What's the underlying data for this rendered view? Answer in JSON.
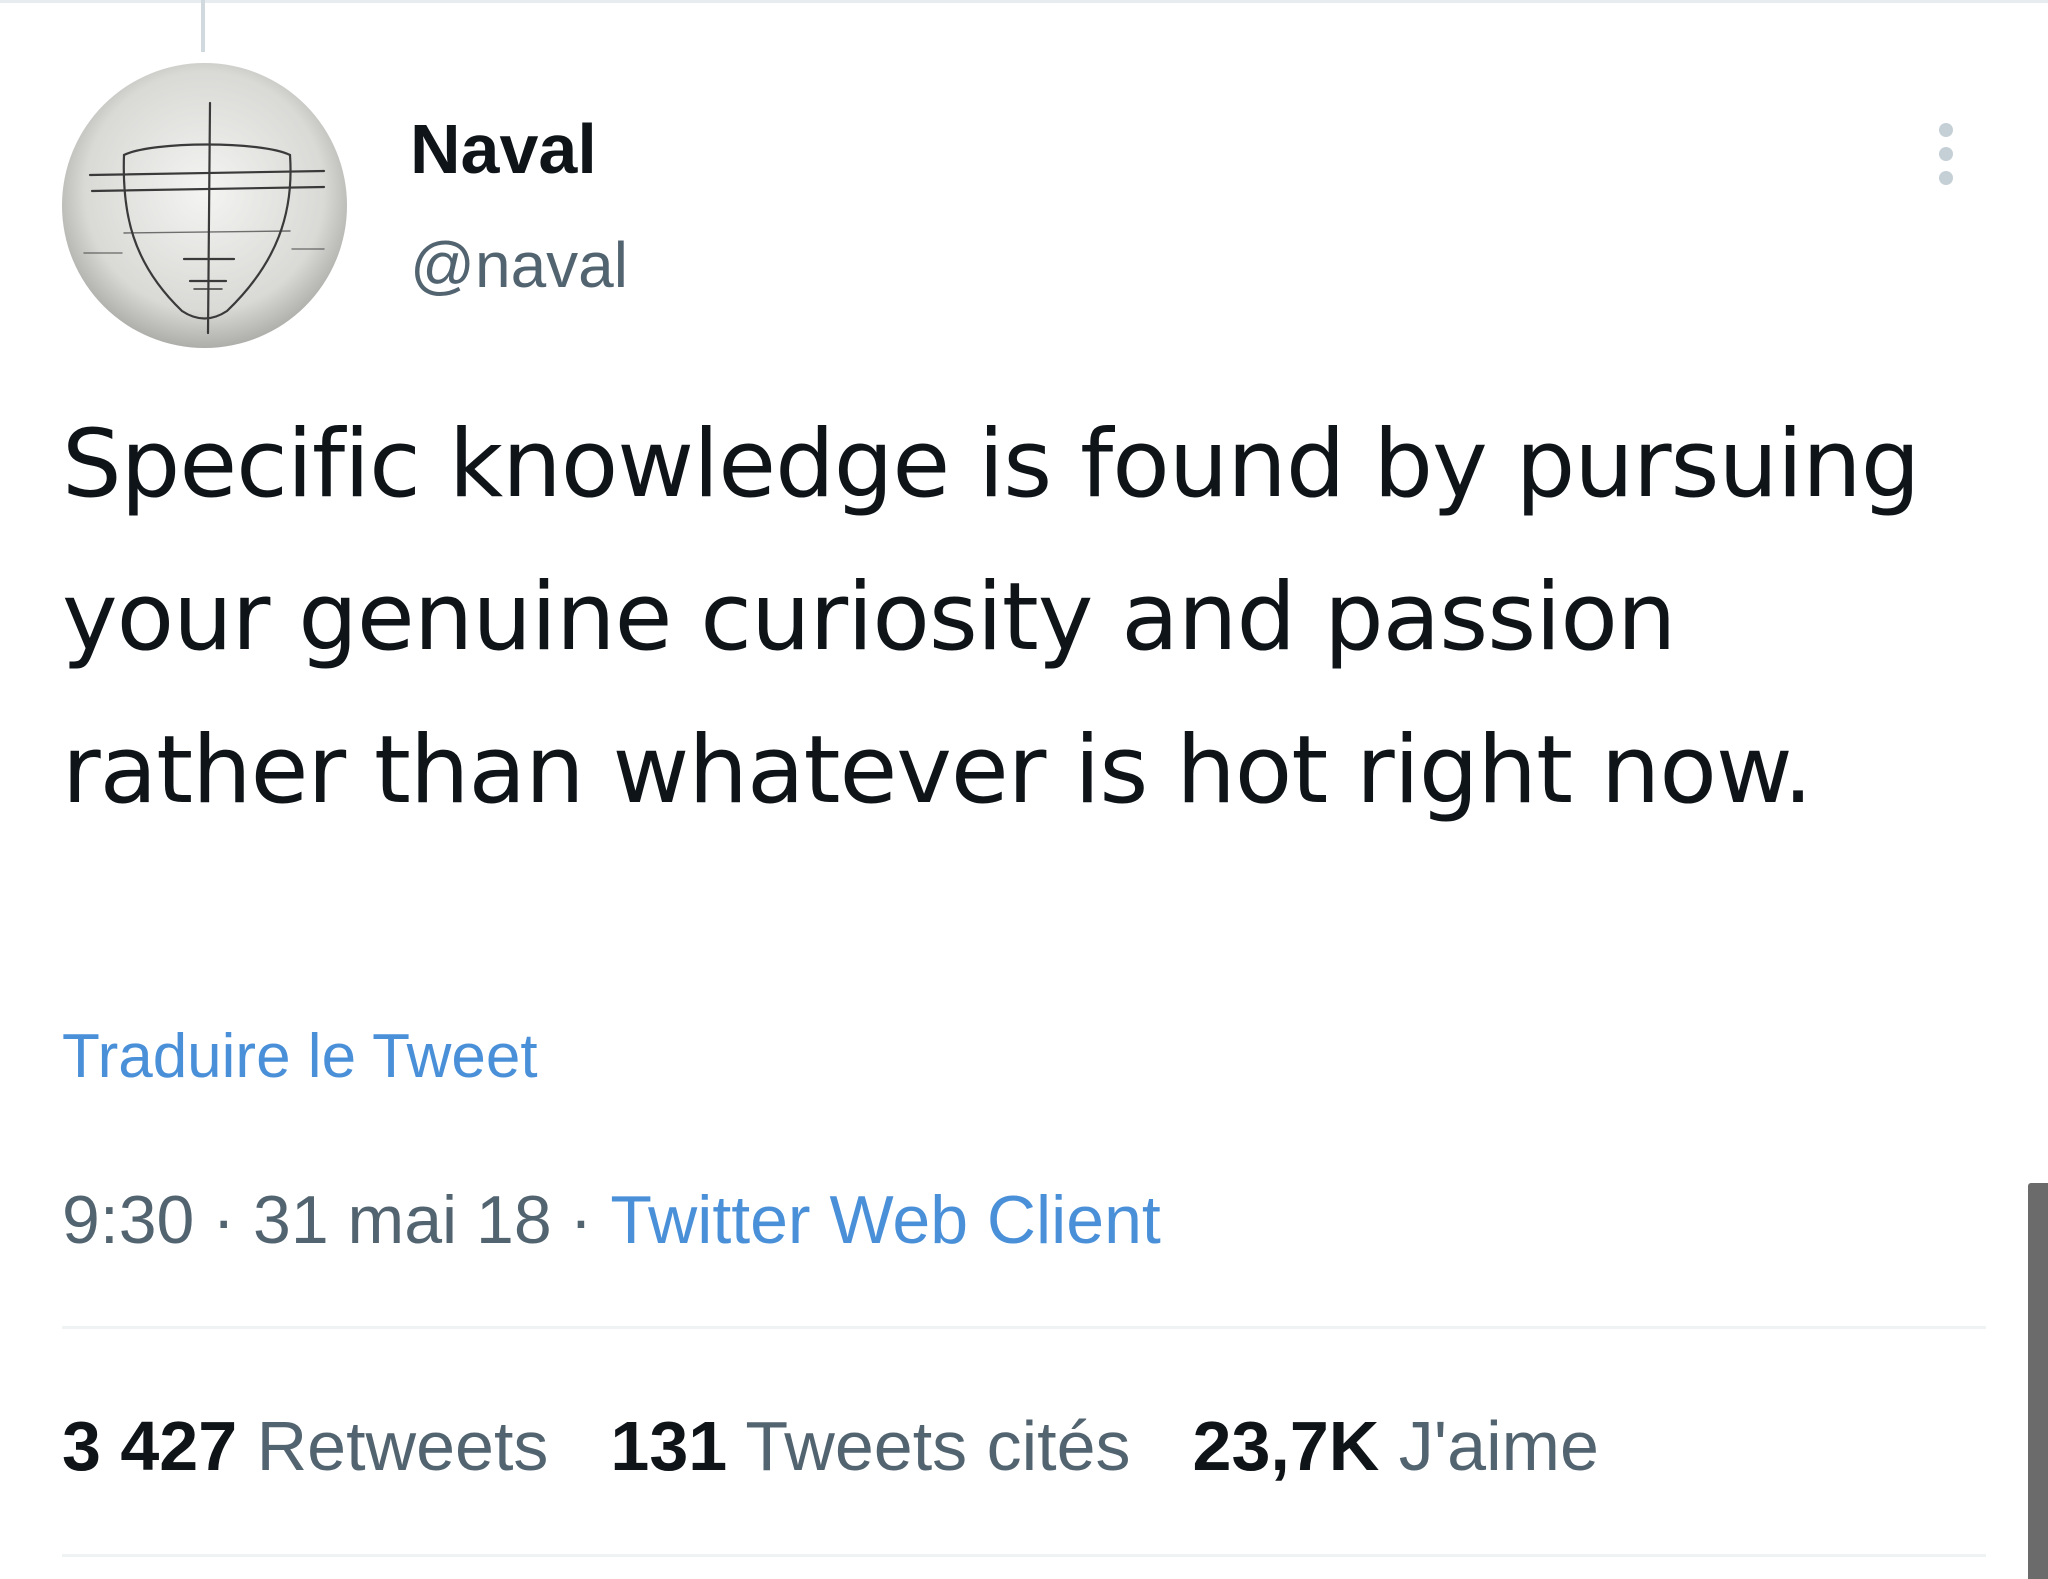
{
  "author": {
    "display_name": "Naval",
    "handle": "@naval",
    "avatar_icon": "sketched-face-avatar"
  },
  "tweet": {
    "text": "Specific knowledge is found by pursuing your genuine curiosity and passion rather than whatever is hot right now.",
    "translate_label": "Traduire le Tweet",
    "time": "9:30",
    "date": "31 mai 18",
    "separator": "·",
    "source": "Twitter Web Client"
  },
  "stats": {
    "retweets_count": "3 427",
    "retweets_label": "Retweets",
    "quotes_count": "131",
    "quotes_label": "Tweets cités",
    "likes_count": "23,7K",
    "likes_label": "J'aime"
  },
  "colors": {
    "link": "#4a90d9",
    "text": "#0f1419",
    "secondary": "#536471"
  }
}
